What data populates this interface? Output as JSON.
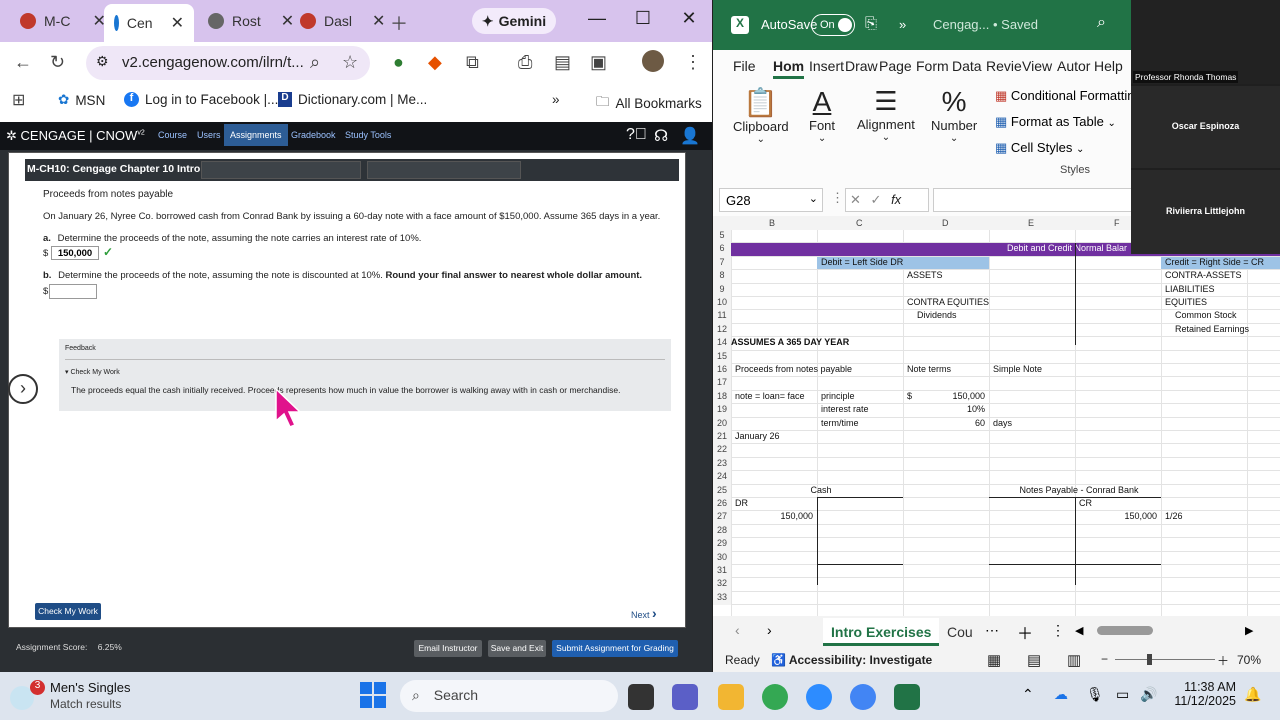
{
  "browser": {
    "tabs": [
      {
        "label": "M-C",
        "color": "#c0392b"
      },
      {
        "label": "Cen",
        "color": "#1976d2"
      },
      {
        "label": "Rost",
        "color": "#555555"
      },
      {
        "label": "Dasl",
        "color": "#c0392b"
      }
    ],
    "gemini_label": "Gemini",
    "url": "v2.cengagenow.com/ilrn/t...",
    "bookmarks": [
      "MSN",
      "Log in to Facebook |...",
      "Dictionary.com | Me...",
      "All Bookmarks"
    ],
    "more_bookmarks": "»"
  },
  "cengage": {
    "brand": "CENGAGE | CNOW",
    "brand_sup": "v2",
    "nav": [
      "Course",
      "Users",
      "Assignments",
      "Gradebook",
      "Study Tools"
    ],
    "active_nav": "Assignments",
    "card_title": "M-CH10: Cengage Chapter 10 Intro",
    "problem_title": "Proceeds from notes payable",
    "problem_text": "On January 26, Nyree Co. borrowed cash from Conrad Bank by issuing a 60-day note with a face amount of $150,000. Assume 365 days in a year.",
    "part_a_label": "a.",
    "part_a_text": "Determine the proceeds of the note, assuming the note carries an interest rate of 10%.",
    "part_a_currency": "$",
    "part_a_value": "150,000",
    "part_a_check": "✓",
    "part_b_label": "b.",
    "part_b_text": "Determine the proceeds of the note, assuming the note is discounted at 10%.",
    "part_b_bold": "Round your final answer to nearest whole dollar amount.",
    "part_b_currency": "$",
    "part_b_value": "",
    "feedback_title": "Feedback",
    "check_my_work_toggle": "Check My Work",
    "feedback_text": "The proceeds equal the cash initially received. Proceeds represents how much in value the borrower is walking away with in cash or merchandise.",
    "check_my_work_button": "Check My Work",
    "next_label": "Next",
    "assignment_score_label": "Assignment Score:",
    "assignment_score_value": "6.25%",
    "email_instructor": "Email Instructor",
    "save_and_exit": "Save and Exit",
    "submit": "Submit Assignment for Grading"
  },
  "excel": {
    "autosave_label": "AutoSave",
    "autosave_state": "On",
    "title": "Cengag...  •  Saved",
    "menu": [
      "File",
      "Hom",
      "Insert",
      "Draw",
      "Page",
      "Form",
      "Data",
      "Revie",
      "View",
      "Autor",
      "Help"
    ],
    "active_menu": "Hom",
    "ribbon": {
      "clipboard": "Clipboard",
      "font": "Font",
      "alignment": "Alignment",
      "number": "Number",
      "conditional_formatting": "Conditional Formatting",
      "format_as_table": "Format as Table",
      "cell_styles": "Cell Styles",
      "styles_group": "Styles"
    },
    "name_box": "G28",
    "fx": "fx",
    "columns": [
      "B",
      "C",
      "D",
      "E",
      "F"
    ],
    "rows": [
      {
        "n": "5",
        "cells": []
      },
      {
        "n": "6",
        "cells": [
          {
            "c": "E",
            "v": "Debit and Credit Normal Balar"
          }
        ]
      },
      {
        "n": "7",
        "cells": [
          {
            "c": "C",
            "v": "Debit = Left Side  DR"
          },
          {
            "c": "G",
            "v": "Credit = Right Side = CR"
          }
        ]
      },
      {
        "n": "8",
        "cells": [
          {
            "c": "D",
            "v": "ASSETS"
          },
          {
            "c": "G",
            "v": "CONTRA-ASSETS"
          }
        ]
      },
      {
        "n": "9",
        "cells": [
          {
            "c": "G",
            "v": "LIABILITIES"
          }
        ]
      },
      {
        "n": "10",
        "cells": [
          {
            "c": "D",
            "v": "CONTRA EQUITIES"
          },
          {
            "c": "G",
            "v": "EQUITIES"
          }
        ]
      },
      {
        "n": "11",
        "cells": [
          {
            "c": "D2",
            "v": "Dividends"
          },
          {
            "c": "G2",
            "v": "Common Stock"
          }
        ]
      },
      {
        "n": "12",
        "cells": [
          {
            "c": "G2",
            "v": "Retained Earnings"
          }
        ]
      },
      {
        "n": "14",
        "cells": [
          {
            "c": "A",
            "v": "ASSUMES A 365 DAY YEAR"
          }
        ]
      },
      {
        "n": "15",
        "cells": []
      },
      {
        "n": "16",
        "cells": [
          {
            "c": "B",
            "v": "Proceeds from notes payable"
          },
          {
            "c": "D",
            "v": "Note terms"
          },
          {
            "c": "E",
            "v": "Simple Note"
          }
        ]
      },
      {
        "n": "17",
        "cells": []
      },
      {
        "n": "18",
        "cells": [
          {
            "c": "B",
            "v": "note = loan= face"
          },
          {
            "c": "C",
            "v": "principle"
          },
          {
            "c": "D",
            "v": "$"
          },
          {
            "c": "Dr",
            "v": "150,000"
          }
        ]
      },
      {
        "n": "19",
        "cells": [
          {
            "c": "C",
            "v": "interest rate"
          },
          {
            "c": "Dr",
            "v": "10%"
          }
        ]
      },
      {
        "n": "20",
        "cells": [
          {
            "c": "C",
            "v": "term/time"
          },
          {
            "c": "Dr",
            "v": "60"
          },
          {
            "c": "E",
            "v": "days"
          }
        ]
      },
      {
        "n": "21",
        "cells": [
          {
            "c": "B",
            "v": "January 26"
          }
        ]
      },
      {
        "n": "22",
        "cells": []
      },
      {
        "n": "23",
        "cells": []
      },
      {
        "n": "24",
        "cells": []
      },
      {
        "n": "25",
        "cells": [
          {
            "c": "BC",
            "v": "Cash"
          },
          {
            "c": "EF",
            "v": "Notes Payable - Conrad Bank"
          }
        ]
      },
      {
        "n": "26",
        "cells": [
          {
            "c": "B",
            "v": "DR"
          },
          {
            "c": "F",
            "v": "CR"
          }
        ]
      },
      {
        "n": "27",
        "cells": [
          {
            "c": "Br",
            "v": "150,000"
          },
          {
            "c": "Fr",
            "v": "150,000"
          },
          {
            "c": "G",
            "v": "1/26"
          }
        ]
      },
      {
        "n": "28",
        "cells": []
      },
      {
        "n": "29",
        "cells": []
      },
      {
        "n": "30",
        "cells": []
      },
      {
        "n": "31",
        "cells": []
      },
      {
        "n": "32",
        "cells": []
      },
      {
        "n": "33",
        "cells": []
      }
    ],
    "sheet_tabs": [
      "Intro Exercises",
      "Cou"
    ],
    "active_sheet": "Intro Exercises",
    "status_ready": "Ready",
    "accessibility": "Accessibility: Investigate",
    "zoom": "70%",
    "header_purple": "#7030a0",
    "header_blue": "#9dc3e6"
  },
  "teams": {
    "participants": [
      "Professor Rhonda Thomas",
      "Oscar Espinoza",
      "Riviierra Littlejohn"
    ]
  },
  "taskbar": {
    "notification_badge": "3",
    "notification_title": "Men's Singles",
    "notification_sub": "Match results",
    "search_placeholder": "Search",
    "time": "11:38 AM",
    "date": "11/12/2025"
  }
}
